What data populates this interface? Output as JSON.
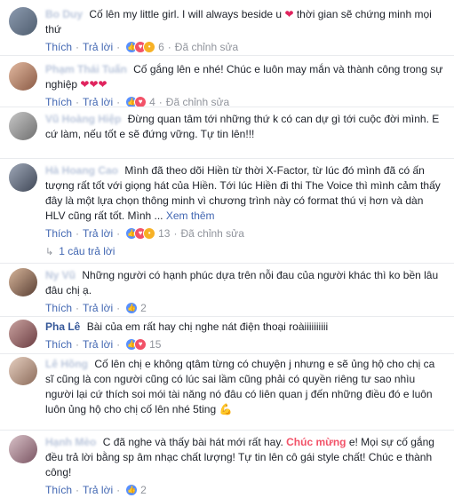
{
  "labels": {
    "like": "Thích",
    "reply": "Trả lời",
    "edited": "Đã chỉnh sửa",
    "see_more": "Xem thêm",
    "one_reply": "1 câu trả lời"
  },
  "comments": [
    {
      "author": "Bo Duy",
      "text_before": "Cố lên my little girl. I will always beside u",
      "heart": "❤",
      "text_after": "thời gian sẽ chứng minh mọi thứ",
      "count": "6",
      "edited": true,
      "reactions": [
        "like",
        "love",
        "wow"
      ]
    },
    {
      "author": "Phạm Thái Tuấn",
      "text_before": "Cố gắng lên e nhé! Chúc e luôn may mắn và thành công trong sự nghiệp",
      "hearts": "❤❤❤",
      "count": "4",
      "edited": true,
      "reactions": [
        "like",
        "love"
      ]
    },
    {
      "author": "Vũ Hoàng Hiệp",
      "text_before": "Đừng quan tâm tới những thứ k có can dự gì tới cuộc đời mình. E cứ làm, nếu tốt e sẽ đứng vững. Tự tin lên!!!",
      "count": "",
      "edited": false,
      "reactions": []
    },
    {
      "author": "Hà Hoang Cao",
      "text_before": "Mình đã theo dõi Hiền từ thời X-Factor, từ lúc đó mình đã có ấn tượng rất tốt với giọng hát của Hiền. Tới lúc Hiền đi thi The Voice thì mình cảm thấy đây là một lựa chọn thông minh vì chương trình này có format thú vị hơn và dàn HLV cũng rất tốt. Mình ...",
      "count": "13",
      "edited": true,
      "reactions": [
        "like",
        "love",
        "wow"
      ]
    },
    {
      "author": "Ny Vũ",
      "text_before": "Những người có hạnh phúc dựa trên nỗi đau của người khác thì ko bền lâu đâu chị ạ.",
      "count": "2",
      "edited": false,
      "reactions": [
        "like"
      ]
    },
    {
      "author": "Pha Lê",
      "text_before": "Bài của em rất hay chị nghe nát điện thoại roàiiiiiiiiii",
      "count": "15",
      "edited": false,
      "reactions": [
        "like",
        "love"
      ]
    },
    {
      "author": "Lê Hồng",
      "text_before": "Cố lên chị e không qtâm từng có chuyện j nhưng e sẽ ủng hộ cho chị ca sĩ cũng là con người cũng có lúc sai lầm cũng phải có quyền riêng tư sao nhìu người lại cứ thích soi mói tài năng nó đâu có liên quan j đến những điều đó e luôn luôn ủng hộ cho chị cố lên nhé 5ting",
      "muscle": "💪",
      "count": "",
      "edited": false,
      "reactions": []
    },
    {
      "author": "Hạnh Mèo",
      "text_before": "C đã nghe và thấy bài hát mới rất hay.",
      "highlight": "Chúc mừng",
      "text_after": "e! Mọi sự cố gắng đều trả lời bằng sp âm nhạc chất lượng! Tự tin lên cô gái style chất! Chúc e thành công!",
      "count": "2",
      "edited": false,
      "reactions": [
        "like"
      ]
    }
  ],
  "colors": {
    "link": "#365899",
    "meta": "#90949c",
    "action": "#4267b2",
    "like": "#5890ff",
    "love": "#f25268",
    "wow": "#f7b125"
  }
}
